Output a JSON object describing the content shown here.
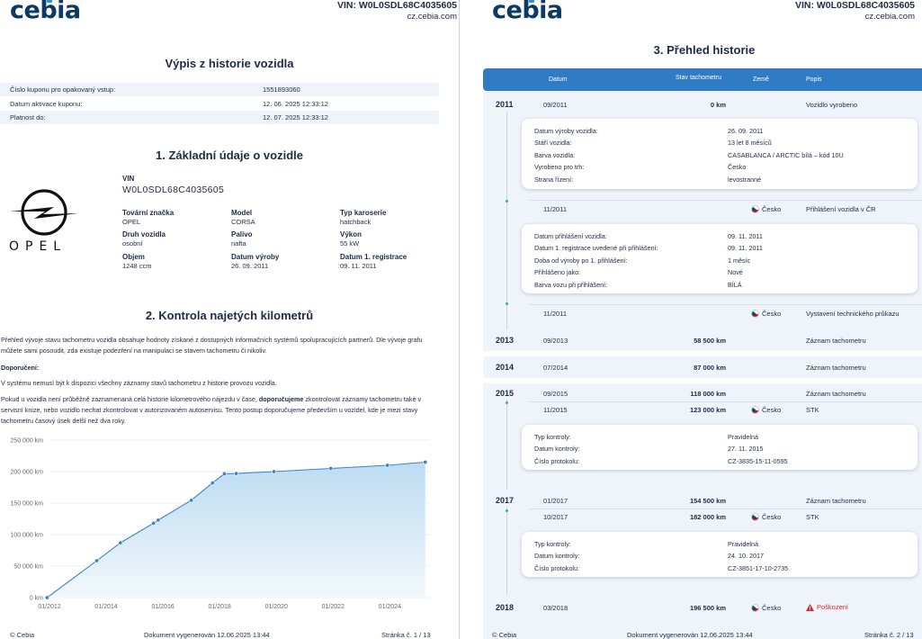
{
  "brand": {
    "logo_text": "cebia",
    "vin_label": "VIN: W0L0SDL68C4035605",
    "url": "cz.cebia.com"
  },
  "page1": {
    "title": "Výpis z historie vozidla",
    "coupon": [
      {
        "label": "Číslo kuponu pro opakovaný vstup:",
        "value": "1551893060"
      },
      {
        "label": "Datum aktivace kuponu:",
        "value": "12. 06. 2025 12:33:12"
      },
      {
        "label": "Platnost do:",
        "value": "12. 07. 2025 12:33:12"
      }
    ],
    "section1_title": "1. Základní údaje o vozidle",
    "make_logo_text": "OPEL",
    "vin": {
      "label": "VIN",
      "value": "W0L0SDL68C4035605"
    },
    "specs": [
      {
        "label": "Tovární značka",
        "value": "OPEL"
      },
      {
        "label": "Model",
        "value": "CORSA"
      },
      {
        "label": "Typ karoserie",
        "value": "hatchback"
      },
      {
        "label": "Druh vozidla",
        "value": "osobní"
      },
      {
        "label": "Palivo",
        "value": "nafta"
      },
      {
        "label": "Výkon",
        "value": "55 kW"
      },
      {
        "label": "Objem",
        "value": "1248 ccm"
      },
      {
        "label": "Datum výroby",
        "value": "26. 09. 2011"
      },
      {
        "label": "Datum 1. registrace",
        "value": "09. 11. 2011"
      }
    ],
    "section2_title": "2. Kontrola najetých kilometrů",
    "para1": "Přehled vývoje stavu tachometru vozidla obsahuje hodnoty získané z dostupných informačních systémů spolupracujících partnerů. Dle vývoje grafu můžete sami posoudit, zda existuje podezření na manipulaci se stavem tachometru či nikoliv.",
    "recommend_label": "Doporučení:",
    "para2": "V systému nemusí být k dispozici všechny záznamy stavů tachometru z historie provozu vozidla.",
    "para3_a": "Pokud u vozidla není průběžně zaznamenaná celá historie kilometrového nájezdu v čase, ",
    "para3_b": "doporučujeme",
    "para3_c": " zkontrolovat záznamy tachometru také v servisní knize, nebo vozidlo nechat zkontrolovat v autorizovaném autoservisu. Tento postup doporučujeme především u vozidel, kde je mezi stavy tachometru časový úsek delší než dva roky.",
    "footer": {
      "left": "© Cebia",
      "center": "Dokument vygenerován 12.06.2025 13:44",
      "right": "Stránka č. 1 / 13"
    }
  },
  "chart_data": {
    "type": "area",
    "y_ticks": [
      "250 000 km",
      "200 000 km",
      "150 000 km",
      "100 000 km",
      "50 000 km",
      "0 km"
    ],
    "x_ticks": [
      "01/2012",
      "01/2014",
      "01/2016",
      "01/2018",
      "01/2020",
      "01/2022",
      "01/2024"
    ],
    "ylim": [
      0,
      250000
    ],
    "xlim": [
      "2012-01",
      "2025-06"
    ],
    "points": [
      {
        "x": "2011-12",
        "y": 0
      },
      {
        "x": "2013-09",
        "y": 58500
      },
      {
        "x": "2014-07",
        "y": 87000
      },
      {
        "x": "2015-09",
        "y": 118000
      },
      {
        "x": "2015-11",
        "y": 123000
      },
      {
        "x": "2017-01",
        "y": 154500
      },
      {
        "x": "2017-10",
        "y": 182000
      },
      {
        "x": "2018-03",
        "y": 196500
      },
      {
        "x": "2018-08",
        "y": 197000
      },
      {
        "x": "2019-12",
        "y": 200000
      },
      {
        "x": "2021-12",
        "y": 205000
      },
      {
        "x": "2023-12",
        "y": 210000
      },
      {
        "x": "2025-04",
        "y": 215000
      }
    ],
    "colors": {
      "line": "#3d84c6",
      "fill_top": "#bcdcf2",
      "fill_bottom": "#f2f8fc"
    }
  },
  "page2": {
    "title": "3. Přehled historie",
    "headers": {
      "date": "Datum",
      "km": "Stav tachometru",
      "country": "Země",
      "desc": "Popis"
    },
    "rows": [
      {
        "year": "2011",
        "date": "09/2011",
        "km": "0 km",
        "country": "",
        "desc": "Vozidlo vyrobeno"
      },
      {
        "year": "",
        "date": "11/2011",
        "km": "",
        "country": "Česko",
        "desc": "Přihlášení vozidla v ČR"
      },
      {
        "year": "",
        "date": "11/2011",
        "km": "",
        "country": "Česko",
        "desc": "Vystavení technického průkazu"
      },
      {
        "year": "2013",
        "date": "09/2013",
        "km": "58 500 km",
        "country": "",
        "desc": "Záznam tachometru"
      },
      {
        "year": "2014",
        "date": "07/2014",
        "km": "87 000 km",
        "country": "",
        "desc": "Záznam tachometru"
      },
      {
        "year": "2015",
        "date": "09/2015",
        "km": "118 000 km",
        "country": "",
        "desc": "Záznam tachometru"
      },
      {
        "year": "",
        "date": "11/2015",
        "km": "123 000 km",
        "country": "Česko",
        "desc": "STK"
      },
      {
        "year": "2017",
        "date": "01/2017",
        "km": "154 500 km",
        "country": "",
        "desc": "Záznam tachometru"
      },
      {
        "year": "",
        "date": "10/2017",
        "km": "182 000 km",
        "country": "Česko",
        "desc": "STK"
      },
      {
        "year": "2018",
        "date": "03/2018",
        "km": "196 500 km",
        "country": "Česko",
        "desc": "Poškození"
      }
    ],
    "cards": [
      {
        "lines": [
          {
            "k": "Datum výroby vozidla:",
            "v": "26. 09. 2011"
          },
          {
            "k": "Stáří vozidla:",
            "v": "13 let 8 měsíců"
          },
          {
            "k": "Barva vozidla:",
            "v": "CASABLANCA / ARCTIC bílá – kód 10U"
          },
          {
            "k": "Vyrobeno pro trh:",
            "v": "Česko"
          },
          {
            "k": "Strana řízení:",
            "v": "levostranné"
          }
        ]
      },
      {
        "lines": [
          {
            "k": "Datum přihlášení vozidla:",
            "v": "09. 11. 2011"
          },
          {
            "k": "Datum 1. registrace uvedené při přihlášení:",
            "v": "09. 11. 2011"
          },
          {
            "k": "Doba od výroby po 1. přihlášení:",
            "v": "1 měsíc"
          },
          {
            "k": "Přihlášeno jako:",
            "v": "Nové"
          },
          {
            "k": "Barva vozu při přihlášení:",
            "v": "BÍLÁ"
          }
        ]
      },
      {
        "lines": [
          {
            "k": "Typ kontroly:",
            "v": "Pravidelná"
          },
          {
            "k": "Datum kontroly:",
            "v": "27. 11. 2015"
          },
          {
            "k": "Číslo protokolu:",
            "v": "CZ-3835-15-11-0595"
          }
        ]
      },
      {
        "lines": [
          {
            "k": "Typ kontroly:",
            "v": "Pravidelná"
          },
          {
            "k": "Datum kontroly:",
            "v": "24. 10. 2017"
          },
          {
            "k": "Číslo protokolu:",
            "v": "CZ-3851-17-10-2735"
          }
        ]
      }
    ],
    "footer": {
      "left": "© Cebia",
      "center": "Dokument vygenerován 12.06.2025 13:44",
      "right": "Stránka č. 2 / 13"
    }
  }
}
